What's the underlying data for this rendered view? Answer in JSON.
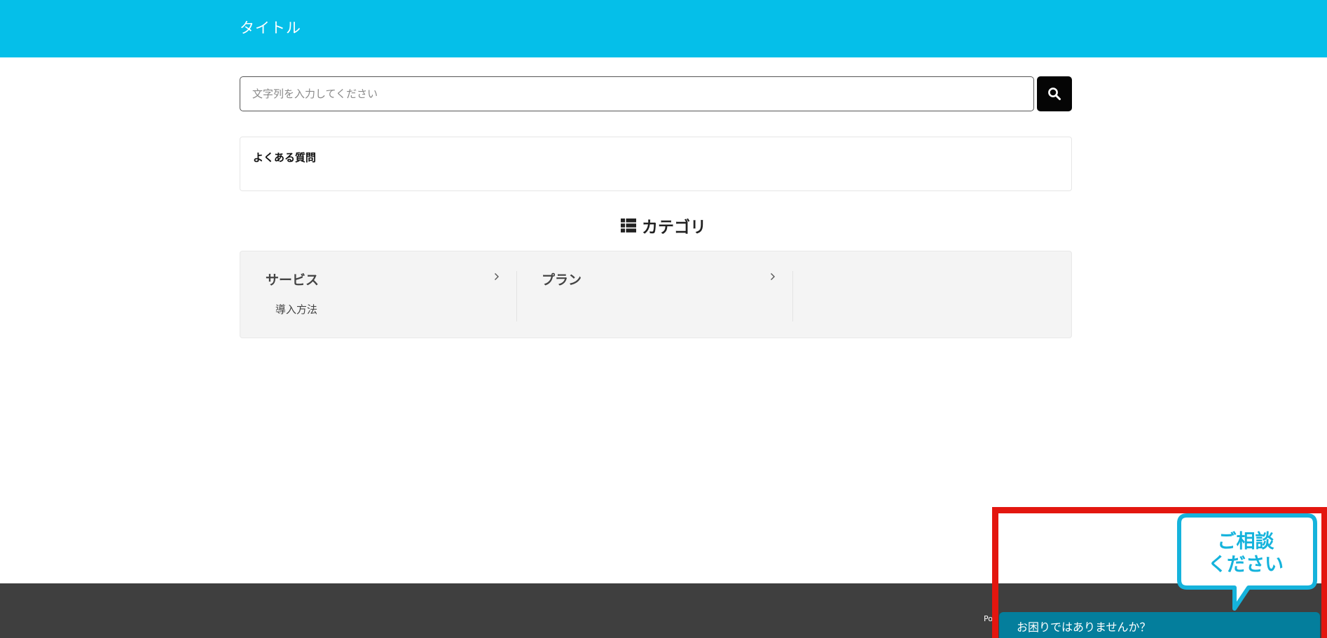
{
  "header": {
    "title": "タイトル"
  },
  "search": {
    "placeholder": "文字列を入力してください",
    "value": "",
    "button_icon": "search-icon"
  },
  "faq": {
    "title": "よくある質問"
  },
  "categories_heading": {
    "label": "カテゴリ",
    "icon": "list-icon"
  },
  "categories": [
    {
      "title": "サービス",
      "items": [
        "導入方法"
      ]
    },
    {
      "title": "プラン",
      "items": []
    }
  ],
  "footer": {
    "powered_text": "Po"
  },
  "chat_widget": {
    "bubble_line1": "ご相談",
    "bubble_line2": "ください",
    "bar_label": "お困りではありませんか？"
  },
  "colors": {
    "header_bg": "#05bfe9",
    "footer_bg": "#3f3f3f",
    "highlight": "#e3160f",
    "chat_bar": "#047e9c",
    "bubble_accent": "#15b3dc"
  }
}
